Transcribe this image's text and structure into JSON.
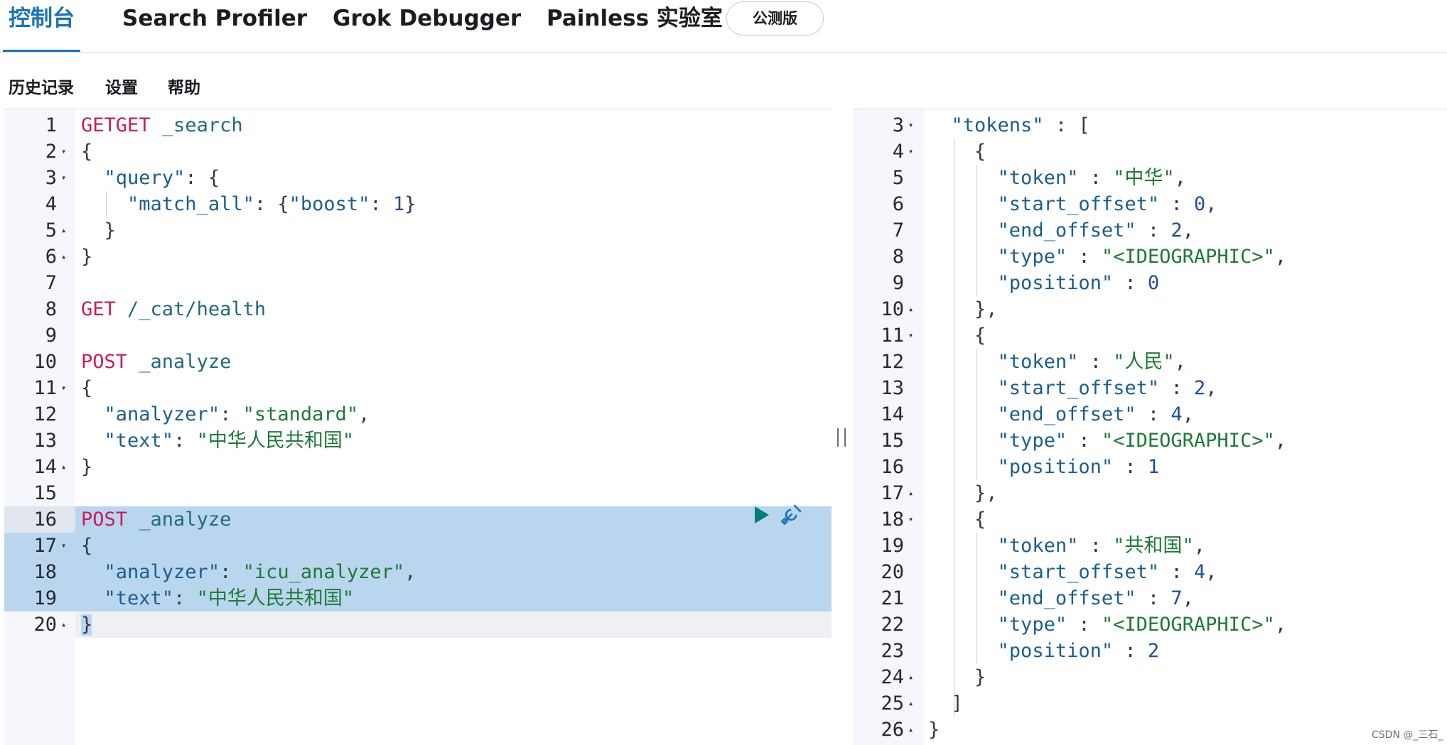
{
  "tabs": [
    {
      "label": "控制台",
      "active": true
    },
    {
      "label": "Search Profiler"
    },
    {
      "label": "Grok Debugger"
    },
    {
      "label": "Painless 实验室"
    }
  ],
  "beta_badge": "公测版",
  "menu": {
    "history": "历史记录",
    "settings": "设置",
    "help": "帮助"
  },
  "editor": {
    "selected_lines": [
      16,
      17,
      18,
      19
    ],
    "lines": [
      {
        "n": "1",
        "fold": "",
        "parts": [
          [
            "m",
            "GETGET"
          ],
          [
            "u",
            " _search"
          ]
        ]
      },
      {
        "n": "2",
        "fold": "down",
        "parts": [
          [
            "p",
            "{"
          ]
        ]
      },
      {
        "n": "3",
        "fold": "down",
        "parts": [
          [
            "p",
            "  "
          ],
          [
            "k",
            "\"query\""
          ],
          [
            "p",
            ": {"
          ]
        ]
      },
      {
        "n": "4",
        "fold": "",
        "parts": [
          [
            "p",
            "    "
          ],
          [
            "k",
            "\"match_all\""
          ],
          [
            "p",
            ": {"
          ],
          [
            "k",
            "\"boost\""
          ],
          [
            "p",
            ": "
          ],
          [
            "n",
            "1"
          ],
          [
            "p",
            "}"
          ]
        ]
      },
      {
        "n": "5",
        "fold": "up",
        "parts": [
          [
            "p",
            "  }"
          ]
        ]
      },
      {
        "n": "6",
        "fold": "up",
        "parts": [
          [
            "p",
            "}"
          ]
        ]
      },
      {
        "n": "7",
        "fold": "",
        "parts": []
      },
      {
        "n": "8",
        "fold": "",
        "parts": [
          [
            "m",
            "GET"
          ],
          [
            "u",
            " /_cat/health"
          ]
        ]
      },
      {
        "n": "9",
        "fold": "",
        "parts": []
      },
      {
        "n": "10",
        "fold": "",
        "parts": [
          [
            "m",
            "POST"
          ],
          [
            "u",
            " _analyze"
          ]
        ]
      },
      {
        "n": "11",
        "fold": "down",
        "parts": [
          [
            "p",
            "{"
          ]
        ]
      },
      {
        "n": "12",
        "fold": "",
        "parts": [
          [
            "p",
            "  "
          ],
          [
            "k",
            "\"analyzer\""
          ],
          [
            "p",
            ": "
          ],
          [
            "s",
            "\"standard\""
          ],
          [
            "p",
            ","
          ]
        ]
      },
      {
        "n": "13",
        "fold": "",
        "parts": [
          [
            "p",
            "  "
          ],
          [
            "k",
            "\"text\""
          ],
          [
            "p",
            ": "
          ],
          [
            "s",
            "\"中华人民共和国\""
          ]
        ]
      },
      {
        "n": "14",
        "fold": "up",
        "parts": [
          [
            "p",
            "}"
          ]
        ]
      },
      {
        "n": "15",
        "fold": "",
        "parts": []
      },
      {
        "n": "16",
        "fold": "",
        "parts": [
          [
            "m",
            "POST"
          ],
          [
            "u",
            " _analyze"
          ]
        ]
      },
      {
        "n": "17",
        "fold": "down",
        "parts": [
          [
            "p",
            "{"
          ]
        ]
      },
      {
        "n": "18",
        "fold": "",
        "parts": [
          [
            "p",
            "  "
          ],
          [
            "k",
            "\"analyzer\""
          ],
          [
            "p",
            ": "
          ],
          [
            "s",
            "\"icu_analyzer\""
          ],
          [
            "p",
            ","
          ]
        ]
      },
      {
        "n": "19",
        "fold": "",
        "parts": [
          [
            "p",
            "  "
          ],
          [
            "k",
            "\"text\""
          ],
          [
            "p",
            ": "
          ],
          [
            "s",
            "\"中华人民共和国\""
          ]
        ]
      },
      {
        "n": "20",
        "fold": "up",
        "parts": [
          [
            "p",
            "}"
          ]
        ]
      }
    ]
  },
  "output": {
    "lines": [
      {
        "n": "3",
        "fold": "down",
        "parts": [
          [
            "p",
            "  "
          ],
          [
            "k",
            "\"tokens\""
          ],
          [
            "p",
            " : ["
          ]
        ]
      },
      {
        "n": "4",
        "fold": "down",
        "parts": [
          [
            "p",
            "    {"
          ]
        ]
      },
      {
        "n": "5",
        "fold": "",
        "parts": [
          [
            "p",
            "      "
          ],
          [
            "k",
            "\"token\""
          ],
          [
            "p",
            " : "
          ],
          [
            "s",
            "\"中华\""
          ],
          [
            "p",
            ","
          ]
        ]
      },
      {
        "n": "6",
        "fold": "",
        "parts": [
          [
            "p",
            "      "
          ],
          [
            "k",
            "\"start_offset\""
          ],
          [
            "p",
            " : "
          ],
          [
            "n",
            "0"
          ],
          [
            "p",
            ","
          ]
        ]
      },
      {
        "n": "7",
        "fold": "",
        "parts": [
          [
            "p",
            "      "
          ],
          [
            "k",
            "\"end_offset\""
          ],
          [
            "p",
            " : "
          ],
          [
            "n",
            "2"
          ],
          [
            "p",
            ","
          ]
        ]
      },
      {
        "n": "8",
        "fold": "",
        "parts": [
          [
            "p",
            "      "
          ],
          [
            "k",
            "\"type\""
          ],
          [
            "p",
            " : "
          ],
          [
            "s",
            "\"<IDEOGRAPHIC>\""
          ],
          [
            "p",
            ","
          ]
        ]
      },
      {
        "n": "9",
        "fold": "",
        "parts": [
          [
            "p",
            "      "
          ],
          [
            "k",
            "\"position\""
          ],
          [
            "p",
            " : "
          ],
          [
            "n",
            "0"
          ]
        ]
      },
      {
        "n": "10",
        "fold": "up",
        "parts": [
          [
            "p",
            "    },"
          ]
        ]
      },
      {
        "n": "11",
        "fold": "down",
        "parts": [
          [
            "p",
            "    {"
          ]
        ]
      },
      {
        "n": "12",
        "fold": "",
        "parts": [
          [
            "p",
            "      "
          ],
          [
            "k",
            "\"token\""
          ],
          [
            "p",
            " : "
          ],
          [
            "s",
            "\"人民\""
          ],
          [
            "p",
            ","
          ]
        ]
      },
      {
        "n": "13",
        "fold": "",
        "parts": [
          [
            "p",
            "      "
          ],
          [
            "k",
            "\"start_offset\""
          ],
          [
            "p",
            " : "
          ],
          [
            "n",
            "2"
          ],
          [
            "p",
            ","
          ]
        ]
      },
      {
        "n": "14",
        "fold": "",
        "parts": [
          [
            "p",
            "      "
          ],
          [
            "k",
            "\"end_offset\""
          ],
          [
            "p",
            " : "
          ],
          [
            "n",
            "4"
          ],
          [
            "p",
            ","
          ]
        ]
      },
      {
        "n": "15",
        "fold": "",
        "parts": [
          [
            "p",
            "      "
          ],
          [
            "k",
            "\"type\""
          ],
          [
            "p",
            " : "
          ],
          [
            "s",
            "\"<IDEOGRAPHIC>\""
          ],
          [
            "p",
            ","
          ]
        ]
      },
      {
        "n": "16",
        "fold": "",
        "parts": [
          [
            "p",
            "      "
          ],
          [
            "k",
            "\"position\""
          ],
          [
            "p",
            " : "
          ],
          [
            "n",
            "1"
          ]
        ]
      },
      {
        "n": "17",
        "fold": "up",
        "parts": [
          [
            "p",
            "    },"
          ]
        ]
      },
      {
        "n": "18",
        "fold": "down",
        "parts": [
          [
            "p",
            "    {"
          ]
        ]
      },
      {
        "n": "19",
        "fold": "",
        "parts": [
          [
            "p",
            "      "
          ],
          [
            "k",
            "\"token\""
          ],
          [
            "p",
            " : "
          ],
          [
            "s",
            "\"共和国\""
          ],
          [
            "p",
            ","
          ]
        ]
      },
      {
        "n": "20",
        "fold": "",
        "parts": [
          [
            "p",
            "      "
          ],
          [
            "k",
            "\"start_offset\""
          ],
          [
            "p",
            " : "
          ],
          [
            "n",
            "4"
          ],
          [
            "p",
            ","
          ]
        ]
      },
      {
        "n": "21",
        "fold": "",
        "parts": [
          [
            "p",
            "      "
          ],
          [
            "k",
            "\"end_offset\""
          ],
          [
            "p",
            " : "
          ],
          [
            "n",
            "7"
          ],
          [
            "p",
            ","
          ]
        ]
      },
      {
        "n": "22",
        "fold": "",
        "parts": [
          [
            "p",
            "      "
          ],
          [
            "k",
            "\"type\""
          ],
          [
            "p",
            " : "
          ],
          [
            "s",
            "\"<IDEOGRAPHIC>\""
          ],
          [
            "p",
            ","
          ]
        ]
      },
      {
        "n": "23",
        "fold": "",
        "parts": [
          [
            "p",
            "      "
          ],
          [
            "k",
            "\"position\""
          ],
          [
            "p",
            " : "
          ],
          [
            "n",
            "2"
          ]
        ]
      },
      {
        "n": "24",
        "fold": "up",
        "parts": [
          [
            "p",
            "    }"
          ]
        ]
      },
      {
        "n": "25",
        "fold": "up",
        "parts": [
          [
            "p",
            "  ]"
          ]
        ]
      },
      {
        "n": "26",
        "fold": "up",
        "parts": [
          [
            "p",
            "}"
          ]
        ]
      }
    ]
  },
  "watermark": "CSDN @_三石_",
  "icons": [
    "play-icon",
    "wrench-icon",
    "fold-arrow-icon",
    "resize-grip-icon"
  ],
  "colors": {
    "accent": "#1a73b9",
    "method": "#c61e5b",
    "string": "#1d7a35",
    "key": "#1a5e8e",
    "selection": "#bad6ee"
  }
}
